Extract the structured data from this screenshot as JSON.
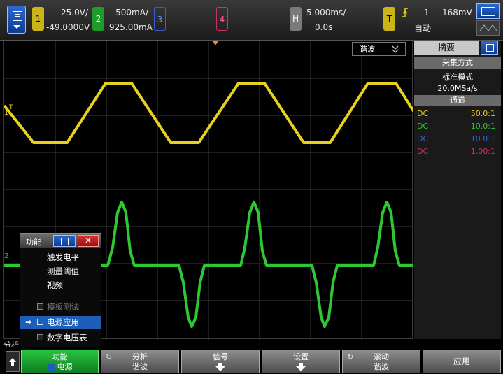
{
  "topbar": {
    "ch1": {
      "num": "1",
      "scale": "25.0V/",
      "offset": "-49.0000V",
      "color": "#e8d01e"
    },
    "ch2": {
      "num": "2",
      "scale": "500mA/",
      "offset": "925.00mA",
      "color": "#2ec832"
    },
    "ch3": {
      "num": "3",
      "color": "#3a5ccf"
    },
    "ch4": {
      "num": "4",
      "color": "#d0306a"
    },
    "horizontal": {
      "label": "H",
      "timebase": "5.000ms/",
      "delay": "0.0s"
    },
    "trigger": {
      "label": "T",
      "source": "1",
      "level": "168mV",
      "mode": "自动"
    }
  },
  "plot": {
    "mode_dropdown": "谐波",
    "ch1_marker": "1",
    "trigger_marker": "T",
    "ch2_marker": "2",
    "bottom_cut_label": "分析"
  },
  "sidepanel": {
    "tab": "摘要",
    "acq_header": "采集方式",
    "acq_mode": "标准模式",
    "sample_rate": "20.0MSa/s",
    "channels_header": "通道",
    "channels": [
      {
        "coupling": "DC",
        "ratio": "50.0:1",
        "color": "#e8d01e"
      },
      {
        "coupling": "DC",
        "ratio": "10.0:1",
        "color": "#2ec832"
      },
      {
        "coupling": "DC",
        "ratio": "10.0:1",
        "color": "#3a5ccf"
      },
      {
        "coupling": "DC",
        "ratio": "1.00:1",
        "color": "#d0306a"
      }
    ]
  },
  "popup": {
    "title": "功能",
    "items": [
      "触发电平",
      "测量阈值",
      "视频"
    ],
    "checkbox_items": [
      "模板测试",
      "电源应用",
      "数字电压表"
    ]
  },
  "softkeys": [
    {
      "line1": "功能",
      "line2": "电源"
    },
    {
      "line1": "分析",
      "line2": "谐波"
    },
    {
      "line1": "信号"
    },
    {
      "line1": "设置"
    },
    {
      "line1": "滚动",
      "line2": "谐波"
    },
    {
      "line1": "应用"
    }
  ]
}
